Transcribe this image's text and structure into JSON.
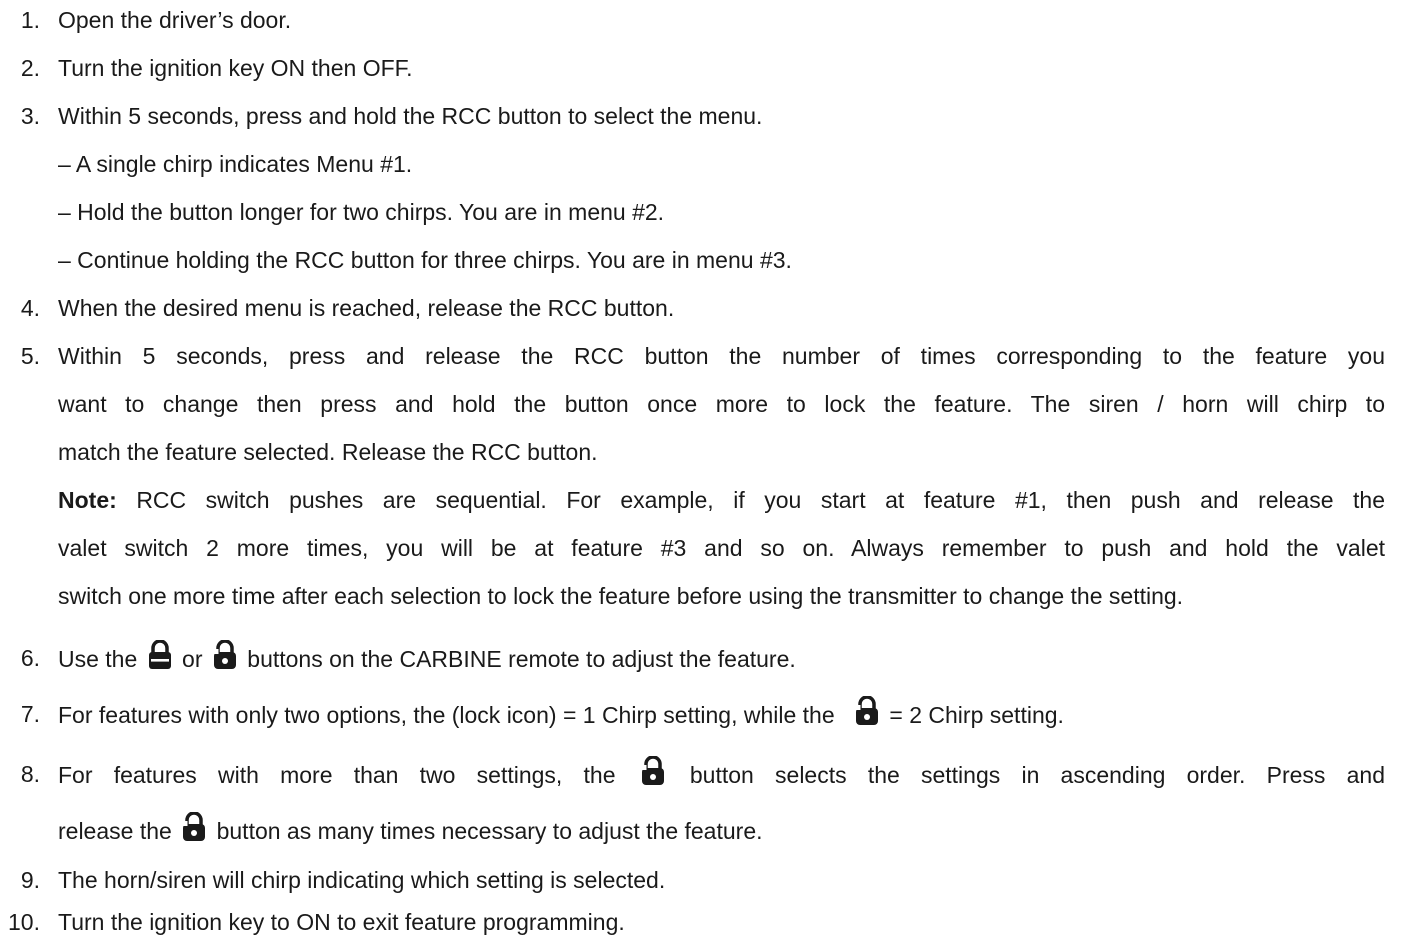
{
  "steps": [
    {
      "num": "1.",
      "text": "Open the driver’s door."
    },
    {
      "num": "2.",
      "text": "Turn the ignition key ON then OFF."
    },
    {
      "num": "3.",
      "text": "Within 5 seconds, press and hold the RCC button to select the menu."
    },
    {
      "num": "4.",
      "text": "When the desired menu is reached, release the RCC button."
    },
    {
      "num": "5.",
      "lines": [
        "Within 5 seconds, press and release the RCC button the number of times corresponding to the feature you",
        "want to change then press and hold the button once more to lock the feature. The siren / horn will chirp to",
        "match the feature selected. Release the RCC button."
      ]
    },
    {
      "num": "6.",
      "pre": "Use the",
      "mid": "or",
      "post": "buttons on the CARBINE remote to adjust the feature."
    },
    {
      "num": "7.",
      "pre": "For features with only two options, the (lock icon) = 1 Chirp setting, while the",
      "post": "= 2 Chirp setting."
    },
    {
      "num": "8.",
      "pre": "For features with more than two settings, the",
      "post": "button selects the settings in ascending order. Press and",
      "line2_pre": "release the",
      "line2_post": "button as many times necessary to adjust the feature."
    },
    {
      "num": "9.",
      "text": "The horn/siren will chirp indicating which setting is selected."
    },
    {
      "num": "10.",
      "text": "Turn the ignition key to ON to exit feature programming."
    }
  ],
  "step3_sub": [
    "– A single chirp indicates Menu #1.",
    "– Hold the button longer for two chirps. You are in menu #2.",
    "– Continue holding the RCC button for three chirps. You are in menu #3."
  ],
  "note": {
    "label": "Note:",
    "line1": "RCC switch pushes are sequential. For example, if you start at feature #1, then push and release the",
    "line2": "valet switch 2 more times, you will be at feature #3 and so on. Always remember to push and hold the valet",
    "line3": "switch one more time after each selection to lock the feature before using the transmitter to change the setting."
  },
  "icons": {
    "locked": "lock-closed-icon",
    "unlocked": "lock-open-icon",
    "color": "#1a1a1a"
  }
}
